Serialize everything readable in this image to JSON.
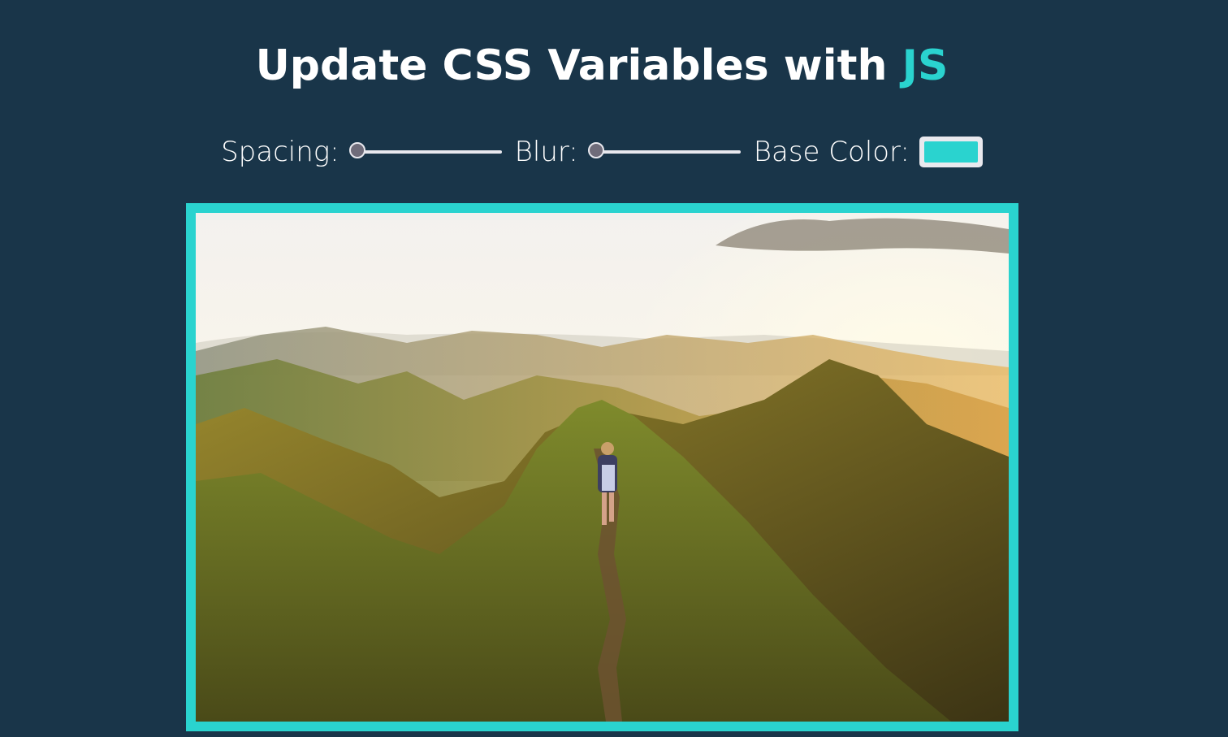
{
  "header": {
    "title_main": "Update CSS Variables with",
    "title_highlight": "JS"
  },
  "controls": {
    "spacing": {
      "label": "Spacing:",
      "value_fraction": 0
    },
    "blur": {
      "label": "Blur:",
      "value_fraction": 0
    },
    "base_color": {
      "label": "Base Color:",
      "value": "#2ad3cf"
    }
  },
  "colors": {
    "background": "#193549",
    "accent": "#2ad3cf"
  },
  "image": {
    "subject_icon": "mountain-ridge-hiker-photo"
  }
}
